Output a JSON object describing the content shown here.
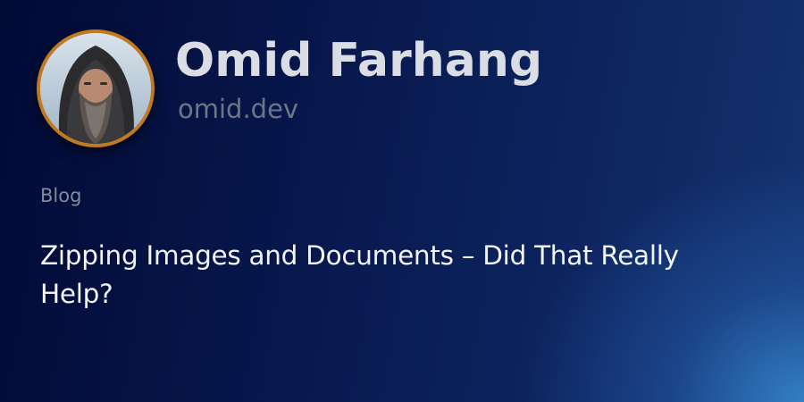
{
  "profile": {
    "name": "Omid Farhang",
    "domain": "omid.dev",
    "avatar_icon": "user-avatar-photo",
    "avatar_border_color": "#c17a1f"
  },
  "post": {
    "category": "Blog",
    "title": "Zipping Images and Documents – Did That Really Help?"
  },
  "colors": {
    "background_dark": "#020a36",
    "background_glow": "#388cd2",
    "name_text": "#dadde3",
    "muted_text": "#6e7585",
    "title_text": "#f2f4f8"
  }
}
